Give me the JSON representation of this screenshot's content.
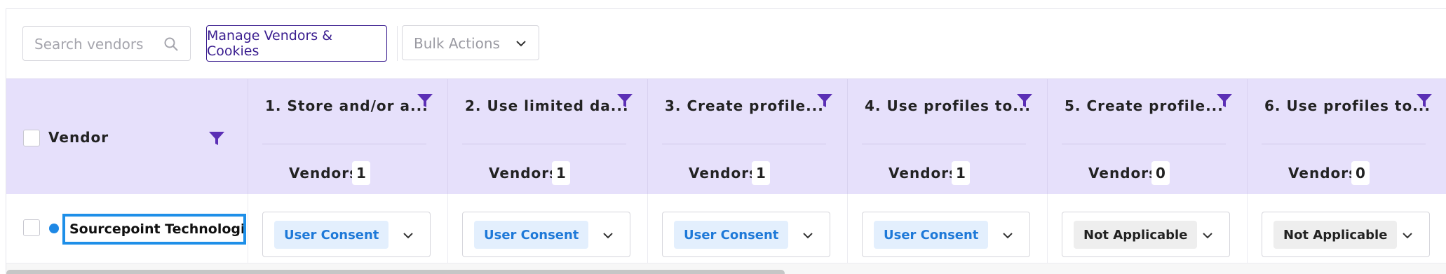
{
  "toolbar": {
    "search_placeholder": "Search vendors",
    "manage_label": "Manage Vendors & Cookies",
    "bulk_label": "Bulk Actions"
  },
  "header": {
    "vendor_label": "Vendor",
    "vendors_label": "Vendors:",
    "columns": [
      {
        "title": "1. Store and/or a...",
        "count": "1"
      },
      {
        "title": "2. Use limited da...",
        "count": "1"
      },
      {
        "title": "3. Create profile...",
        "count": "1"
      },
      {
        "title": "4. Use profiles to...",
        "count": "1"
      },
      {
        "title": "5. Create profile...",
        "count": "0"
      },
      {
        "title": "6. Use profiles to...",
        "count": "0"
      }
    ]
  },
  "row": {
    "vendor_name": "Sourcepoint Technologies...",
    "cells": [
      {
        "value": "User Consent"
      },
      {
        "value": "User Consent"
      },
      {
        "value": "User Consent"
      },
      {
        "value": "User Consent"
      },
      {
        "value": "Not Applicable"
      },
      {
        "value": "Not Applicable"
      }
    ]
  },
  "colors": {
    "header_bg": "#e6e0fb",
    "accent": "#3a1d8f",
    "filter_icon": "#5b2fb5",
    "consent_text": "#1e79d8",
    "consent_bg": "#e3effd",
    "selection_border": "#1e8fe8"
  },
  "icons": {
    "search": "search-icon",
    "filter": "filter-icon",
    "chevron": "chevron-down-icon"
  }
}
